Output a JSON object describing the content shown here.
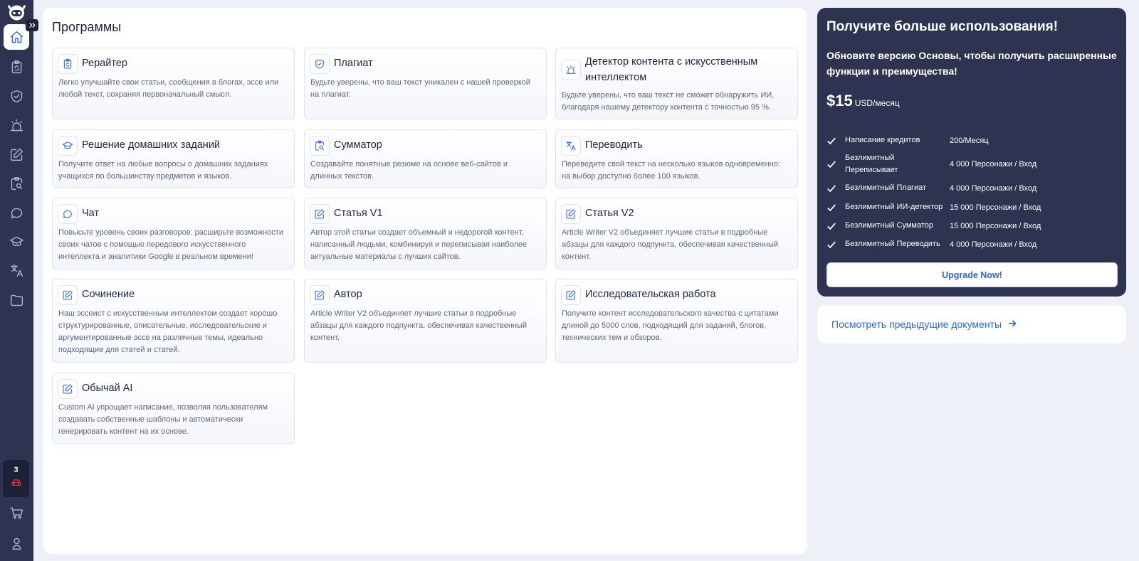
{
  "sidebar": {
    "items": [
      {
        "name": "home-icon"
      },
      {
        "name": "rewriter-icon"
      },
      {
        "name": "plagiarism-icon"
      },
      {
        "name": "ai-detector-icon"
      },
      {
        "name": "edit-icon"
      },
      {
        "name": "summarizer-icon"
      },
      {
        "name": "chat-icon"
      },
      {
        "name": "homework-icon"
      },
      {
        "name": "translate-icon"
      },
      {
        "name": "folder-icon"
      }
    ],
    "credits_count": "3"
  },
  "main": {
    "title": "Программы",
    "cards": [
      {
        "title": "Рерайтер",
        "desc": "Легко улучшайте свои статьи, сообщения в блогах, эссе или любой текст, сохраняя первоначальный смысл.",
        "icon": "rewriter-icon"
      },
      {
        "title": "Плагиат",
        "desc": "Будьте уверены, что ваш текст уникален с нашей проверкой на плагиат.",
        "icon": "shield-check-icon"
      },
      {
        "title": "Детектор контента с искусственным интеллектом",
        "desc": "Будьте уверены, что ваш текст не сможет обнаружить ИИ, благодаря нашему детектору контента с точностью 95 %.",
        "icon": "alarm-icon"
      },
      {
        "title": "Решение домашних заданий",
        "desc": "Получите ответ на любые вопросы о домашних заданиях учащихся по большинству предметов и языков.",
        "icon": "graduation-cap-icon"
      },
      {
        "title": "Сумматор",
        "desc": "Создавайте понятные резюме на основе веб-сайтов и длинных текстов.",
        "icon": "clipboard-search-icon"
      },
      {
        "title": "Переводить",
        "desc": "Переведите свой текст на несколько языков одновременно: на выбор доступно более 100 языков.",
        "icon": "translate-icon"
      },
      {
        "title": "Чат",
        "desc": "Повысьте уровень своих разговоров: расширьте возможности своих чатов с помощью передового искусственного интеллекта и аналитики Google в реальном времени!",
        "icon": "chat-icon"
      },
      {
        "title": "Статья V1",
        "desc": "Автор этой статьи создает объемный и недорогой контент, написанный людьми, комбинируя и переписывая наиболее актуальные материалы с лучших сайтов.",
        "icon": "edit-icon"
      },
      {
        "title": "Статья V2",
        "desc": "Article Writer V2 объединяет лучшие статьи в подробные абзацы для каждого подпункта, обеспечивая качественный контент.",
        "icon": "edit-icon"
      },
      {
        "title": "Сочинение",
        "desc": "Наш эссеист с искусственным интеллектом создает хорошо структурированные, описательные, исследовательские и аргументированные эссе на различные темы, идеально подходящие для статей и статей.",
        "icon": "edit-icon"
      },
      {
        "title": "Автор",
        "desc": "Article Writer V2 объединяет лучшие статьи в подробные абзацы для каждого подпункта, обеспечивая качественный контент.",
        "icon": "edit-icon"
      },
      {
        "title": "Исследовательская работа",
        "desc": "Получите контент исследовательского качества с цитатами длиной до 5000 слов, подходящий для заданий, блогов, технических тем и обзоров.",
        "icon": "edit-icon"
      },
      {
        "title": "Обычай AI",
        "desc": "Custom AI упрощает написание, позволяя пользователям создавать собственные шаблоны и автоматически генерировать контент на их основе.",
        "icon": "edit-icon"
      }
    ]
  },
  "promo": {
    "title": "Получите больше использования!",
    "subtitle": "Обновите версию Основы, чтобы получить расширенные функции и преимущества!",
    "price": "$15",
    "price_unit": "USD/месяц",
    "features": [
      {
        "name": "Написание кредитов",
        "value": "200/Месяц"
      },
      {
        "name": "Безлимитный Переписывает",
        "value": "4 000 Персонажи / Вход"
      },
      {
        "name": "Безлимитный Плагиат",
        "value": "4 000 Персонажи / Вход"
      },
      {
        "name": "Безлимитный ИИ-детектор",
        "value": "15 000 Персонажи / Вход"
      },
      {
        "name": "Безлимитный Сумматор",
        "value": "15 000 Персонажи / Вход"
      },
      {
        "name": "Безлимитный Переводить",
        "value": "4 000 Персонажи / Вход"
      }
    ],
    "upgrade_label": "Upgrade Now!"
  },
  "previous_docs": {
    "label": "Посмотреть предыдущие документы"
  },
  "colors": {
    "accent": "#2f66e0",
    "sidebar_bg": "#2d3350",
    "page_bg": "#eef0f8",
    "credits_icon": "#e53935"
  }
}
